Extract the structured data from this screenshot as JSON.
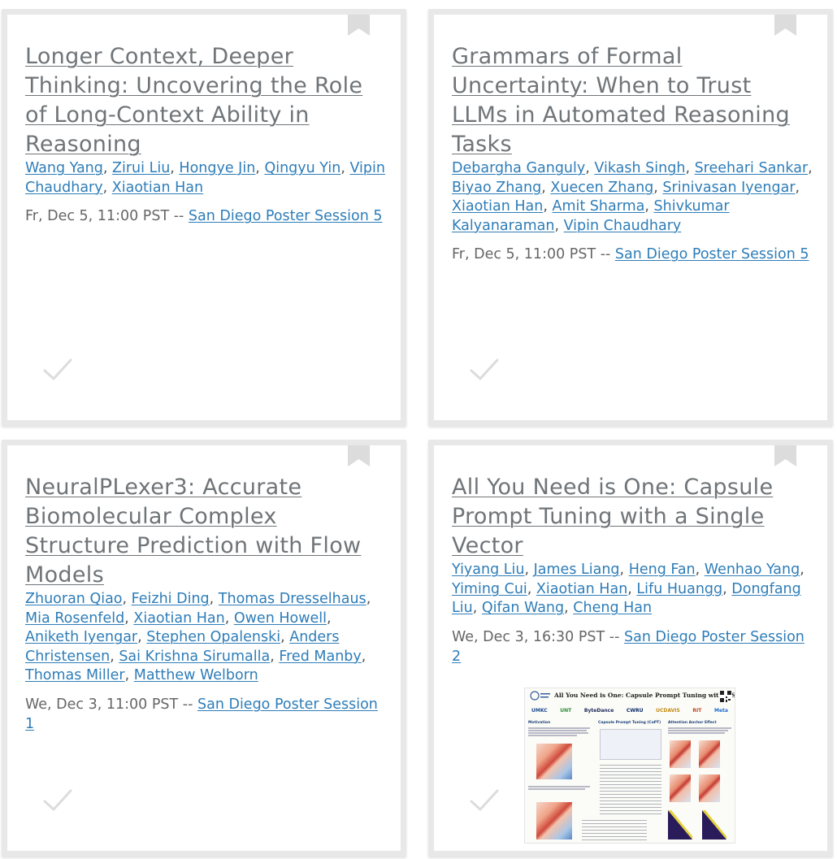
{
  "cards": [
    {
      "title": "Longer Context, Deeper Thinking: Uncovering the Role of Long-Context Ability in Reasoning",
      "authors": [
        "Wang Yang",
        "Zirui Liu",
        "Hongye Jin",
        "Qingyu Yin",
        "Vipin Chaudhary",
        "Xiaotian Han"
      ],
      "datetime": "Fr, Dec 5, 11:00 PST --",
      "session": "San Diego Poster Session 5"
    },
    {
      "title": "Grammars of Formal Uncertainty: When to Trust LLMs in Automated Reasoning Tasks",
      "authors": [
        "Debargha Ganguly",
        "Vikash Singh",
        "Sreehari Sankar",
        "Biyao Zhang",
        "Xuecen Zhang",
        "Srinivasan Iyengar",
        "Xiaotian Han",
        "Amit Sharma",
        "Shivkumar Kalyanaraman",
        "Vipin Chaudhary"
      ],
      "datetime": "Fr, Dec 5, 11:00 PST --",
      "session": "San Diego Poster Session 5"
    },
    {
      "title": "NeuralPLexer3: Accurate Biomolecular Complex Structure Prediction with Flow Models",
      "authors": [
        "Zhuoran Qiao",
        "Feizhi Ding",
        "Thomas Dresselhaus",
        "Mia Rosenfeld",
        "Xiaotian Han",
        "Owen Howell",
        "Aniketh Iyengar",
        "Stephen Opalenski",
        "Anders Christensen",
        "Sai Krishna Sirumalla",
        "Fred Manby",
        "Thomas Miller",
        "Matthew Welborn"
      ],
      "datetime": "We, Dec 3, 11:00 PST --",
      "session": "San Diego Poster Session 1"
    },
    {
      "title": "All You Need is One: Capsule Prompt Tuning with a Single Vector",
      "authors": [
        "Yiyang Liu",
        "James Liang",
        "Heng Fan",
        "Wenhao Yang",
        "Yiming Cui",
        "Xiaotian Han",
        "Lifu Huangg",
        "Dongfang Liu",
        "Qifan Wang",
        "Cheng Han"
      ],
      "datetime": "We, Dec 3, 16:30 PST --",
      "session": "San Diego Poster Session 2",
      "poster": {
        "title": "All You Need is One: Capsule Prompt Tuning with a Single Vector",
        "logos": [
          "UMKC",
          "UNT",
          "ByteDance",
          "CWRU",
          "UCDAVIS",
          "RIT",
          "Meta"
        ],
        "sections": [
          "Motivation",
          "Capsule Prompt Tuning (CaPT)",
          "Attention Anchor Effect"
        ]
      }
    }
  ],
  "colors": {
    "link": "#2e7db8",
    "title": "#6f7478",
    "card_border": "#e8e8e8",
    "icon_gray": "#dcdcdc"
  },
  "icons": {
    "bookmark": "bookmark-icon",
    "check": "check-icon"
  }
}
